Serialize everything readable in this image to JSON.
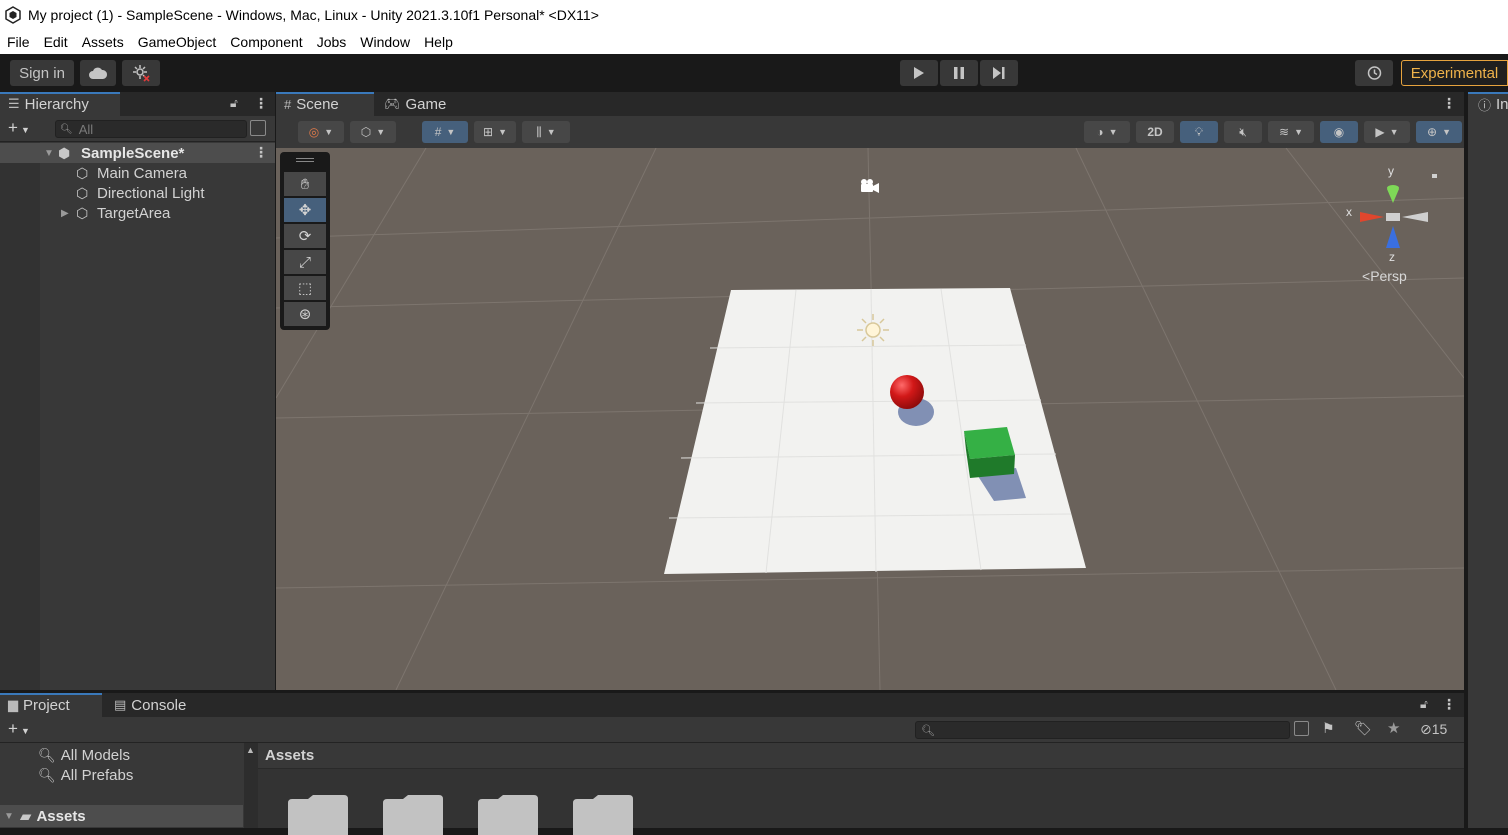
{
  "window": {
    "title": "My project (1) - SampleScene - Windows, Mac, Linux - Unity 2021.3.10f1 Personal* <DX11>"
  },
  "menu": [
    "File",
    "Edit",
    "Assets",
    "GameObject",
    "Component",
    "Jobs",
    "Window",
    "Help"
  ],
  "toolbar": {
    "sign_in": "Sign in",
    "experimental": "Experimental",
    "icons": [
      "cloud-icon",
      "collab-icon",
      "play-icon",
      "pause-icon",
      "step-icon",
      "history-icon"
    ]
  },
  "hierarchy": {
    "tab": "Hierarchy",
    "search_placeholder": "All",
    "items": [
      {
        "label": "SampleScene*",
        "kind": "scene"
      },
      {
        "label": "Main Camera",
        "kind": "object"
      },
      {
        "label": "Directional Light",
        "kind": "object"
      },
      {
        "label": "TargetArea",
        "kind": "object",
        "expandable": true
      }
    ]
  },
  "scene": {
    "tabs": [
      "Scene",
      "Game"
    ],
    "mode_2d": "2D",
    "gizmo": {
      "x": "x",
      "y": "y",
      "z": "z",
      "projection": "Persp"
    },
    "colors": {
      "sphere": "#cc1111",
      "cube": "#2e9e3a",
      "plane": "#f2f2f0",
      "background": "#6a625b"
    }
  },
  "inspector": {
    "tab": "In"
  },
  "project": {
    "tabs": [
      "Project",
      "Console"
    ],
    "favorites": [
      "All Models",
      "All Prefabs"
    ],
    "root": "Assets",
    "breadcrumb": "Assets",
    "hidden_count": "15"
  }
}
